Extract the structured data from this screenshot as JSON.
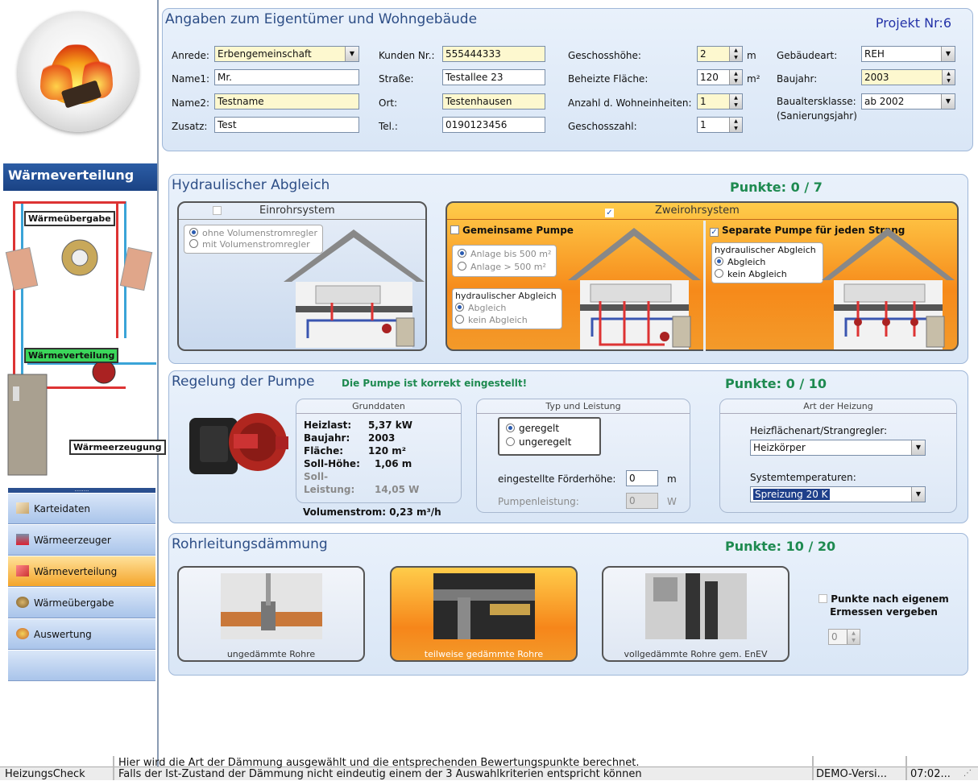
{
  "sidebar": {
    "title": "Wärmeverteilung",
    "diagram_labels": {
      "uebergabe": "Wärmeübergabe",
      "verteilung": "Wärmeverteilung",
      "erzeugung": "Wärmeerzeugung"
    },
    "dots": "........",
    "nav": [
      {
        "label": "Karteidaten",
        "icon": "card-file-icon"
      },
      {
        "label": "Wärmeerzeuger",
        "icon": "boiler-icon"
      },
      {
        "label": "Wärmeverteilung",
        "icon": "distribution-icon",
        "active": true
      },
      {
        "label": "Wärmeübergabe",
        "icon": "radiator-icon"
      },
      {
        "label": "Auswertung",
        "icon": "evaluation-icon"
      }
    ]
  },
  "owner": {
    "title": "Angaben zum Eigentümer und Wohngebäude",
    "project": "Projekt Nr:6",
    "anrede_label": "Anrede:",
    "anrede": "Erbengemeinschaft",
    "name1_label": "Name1:",
    "name1": "Mr.",
    "name2_label": "Name2:",
    "name2": "Testname",
    "zusatz_label": "Zusatz:",
    "zusatz": "Test",
    "kunden_label": "Kunden Nr.:",
    "kunden": "555444333",
    "strasse_label": "Straße:",
    "strasse": "Testallee 23",
    "ort_label": "Ort:",
    "ort": "Testenhausen",
    "tel_label": "Tel.:",
    "tel": "0190123456",
    "geschosshoehe_label": "Geschosshöhe:",
    "geschosshoehe": "2",
    "geschosshoehe_unit": "m",
    "flaeche_label": "Beheizte Fläche:",
    "flaeche": "120",
    "flaeche_unit": "m²",
    "wohneinheiten_label": "Anzahl d. Wohneinheiten:",
    "wohneinheiten": "1",
    "geschosszahl_label": "Geschosszahl:",
    "geschosszahl": "1",
    "gebaeudeart_label": "Gebäudeart:",
    "gebaeudeart": "REH",
    "baujahr_label": "Baujahr:",
    "baujahr": "2003",
    "baualter_label": "Baualtersklasse:",
    "baualter_sub": "(Sanierungsjahr)",
    "baualter": "ab 2002"
  },
  "hydraulic": {
    "title": "Hydraulischer Abgleich",
    "points": "Punkte: 0 / 7",
    "einrohr": {
      "title": "Einrohrsystem",
      "checked": false,
      "options": [
        "ohne Volumenstromregler",
        "mit Volumenstromregler"
      ]
    },
    "zweirohr": {
      "title": "Zweirohrsystem",
      "checked": true
    },
    "gemeinsam": {
      "title": "Gemeinsame Pumpe",
      "checked": false,
      "options": [
        "Anlage bis 500 m²",
        "Anlage > 500 m²"
      ],
      "abgleich_title": "hydraulischer Abgleich",
      "abgleich_options": [
        "Abgleich",
        "kein Abgleich"
      ]
    },
    "separat": {
      "title": "Separate Pumpe für jeden Strang",
      "checked": true,
      "abgleich_title": "hydraulischer Abgleich",
      "abgleich_options": [
        "Abgleich",
        "kein Abgleich"
      ]
    }
  },
  "pump": {
    "title": "Regelung der Pumpe",
    "status": "Die Pumpe ist korrekt eingestellt!",
    "points": "Punkte: 0 / 10",
    "grunddaten": {
      "title": "Grunddaten",
      "rows": [
        {
          "label": "Heizlast:",
          "value": "5,37 kW"
        },
        {
          "label": "Baujahr:",
          "value": "2003"
        },
        {
          "label": "Fläche:",
          "value": "120 m²"
        },
        {
          "label": "Soll-Höhe:",
          "value": "1,06 m"
        }
      ],
      "soll_leistung_label": "Soll-Leistung:",
      "soll_leistung": "14,05 W"
    },
    "volumenstrom_label": "Volumenstrom:",
    "volumenstrom": "0,23 m³/h",
    "typ": {
      "title": "Typ und Leistung",
      "options": [
        "geregelt",
        "ungeregelt"
      ],
      "foerder_label": "eingestellte Förderhöhe:",
      "foerder": "0",
      "foerder_unit": "m",
      "leistung_label": "Pumpenleistung:",
      "leistung": "0",
      "leistung_unit": "W"
    },
    "heizung": {
      "title": "Art der Heizung",
      "strang_label": "Heizflächenart/Strangregler:",
      "strang": "Heizkörper",
      "temp_label": "Systemtemperaturen:",
      "temp": "Spreizung 20 K"
    }
  },
  "insulation": {
    "title": "Rohrleitungsdämmung",
    "points": "Punkte: 10 / 20",
    "options": [
      {
        "label": "ungedämmte Rohre"
      },
      {
        "label": "teilweise gedämmte Rohre",
        "selected": true
      },
      {
        "label": "vollgedämmte Rohre gem. EnEV"
      }
    ],
    "manual_label": "Punkte nach eigenem Ermessen vergeben",
    "manual_value": "0"
  },
  "statusbar": {
    "app": "HeizungsCheck",
    "message1": "Hier wird die Art der Dämmung ausgewählt und die entsprechenden Bewertungspunkte berechnet.",
    "message2": "Falls der Ist-Zustand der Dämmung nicht eindeutig einem der 3 Auswahlkriterien entspricht können",
    "version": "DEMO-Versi...",
    "time": "07:02..."
  }
}
